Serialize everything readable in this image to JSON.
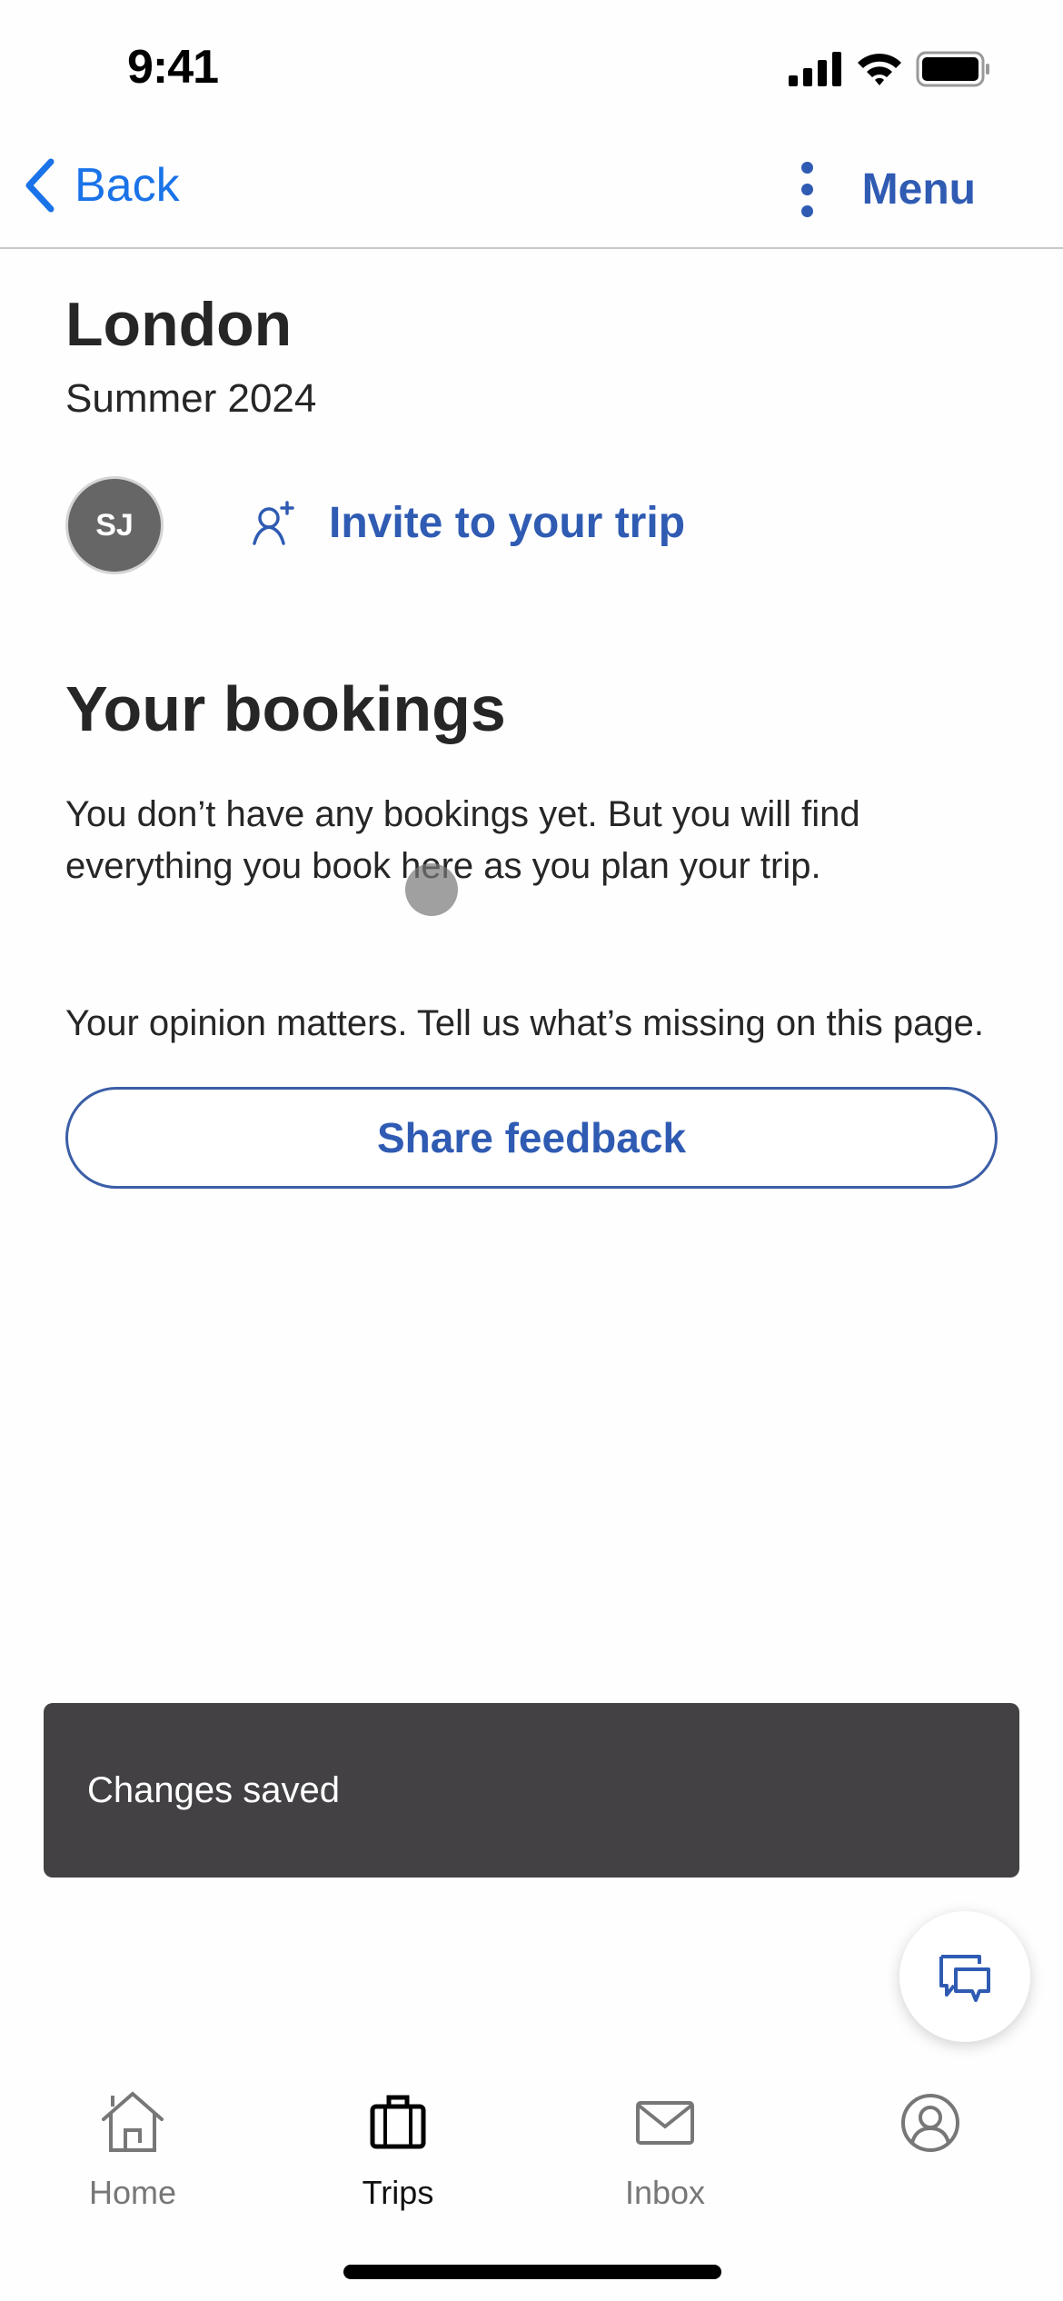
{
  "status_bar": {
    "time": "9:41",
    "icons": [
      "signal-icon",
      "wifi-icon",
      "battery-icon"
    ]
  },
  "nav": {
    "back_label": "Back",
    "menu_label": "Menu"
  },
  "trip": {
    "title": "London",
    "subtitle": "Summer 2024",
    "avatar_initials": "SJ",
    "invite_label": "Invite to your trip"
  },
  "bookings": {
    "title": "Your bookings",
    "empty_text": "You don’t have any bookings yet. But you will find everything you book here as you plan your trip."
  },
  "feedback": {
    "prompt": "Your opinion matters. Tell us what’s missing on this page.",
    "button_label": "Share feedback"
  },
  "toast": {
    "message": "Changes saved"
  },
  "tab_bar": {
    "active": "Trips",
    "items": [
      {
        "label": "Home",
        "icon": "home-icon"
      },
      {
        "label": "Trips",
        "icon": "suitcase-icon"
      },
      {
        "label": "Inbox",
        "icon": "mail-icon"
      },
      {
        "label": "",
        "icon": "profile-icon"
      }
    ]
  },
  "colors": {
    "accent": "#2f5bb3",
    "back_link": "#1a73e8",
    "toast_bg": "#434144",
    "text": "#262626",
    "inactive_tab": "#777777"
  }
}
